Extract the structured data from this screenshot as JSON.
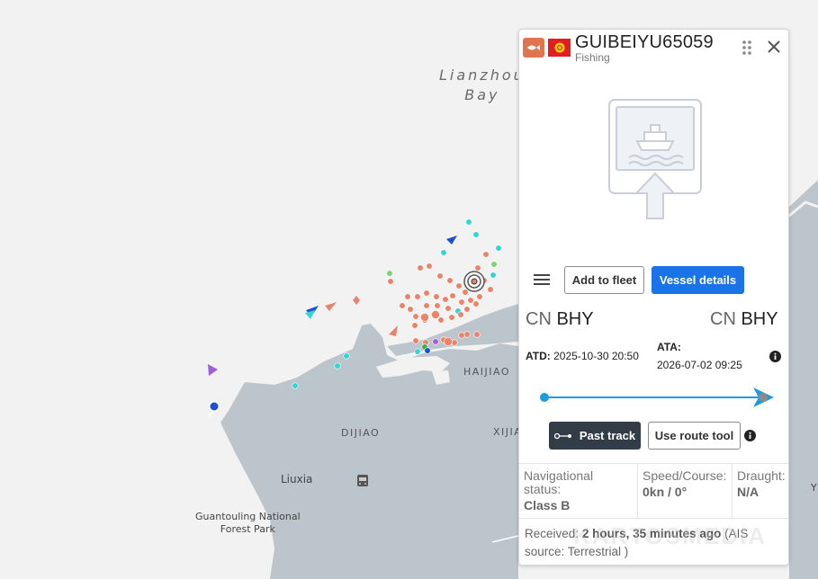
{
  "map": {
    "bay_label_line1": "Lianzhou",
    "bay_label_line2": "Bay",
    "places": {
      "haijiao": "HAIJIAO",
      "dijiao": "DIJIAO",
      "xijiao": "XIJIAO",
      "liuxia": "Liuxia",
      "park_line1": "Guantouling National",
      "park_line2": "Forest Park",
      "right_edge": "Y"
    },
    "colors": {
      "water": "#f2f2f2",
      "land": "#bcc4cc",
      "cargo_vessel": "#e8846a",
      "passenger_vessel": "#35d4d4",
      "pleasure_vessel": "#a15ce0",
      "tanker_vessel": "#1a4fd6"
    }
  },
  "panel": {
    "vessel_name": "GUIBEIYU65059",
    "vessel_type": "Fishing",
    "type_icon": "fishing-boat-icon",
    "flag_icon": "kyrgyzstan-flag-icon",
    "buttons": {
      "add_to_fleet": "Add to fleet",
      "vessel_details": "Vessel details",
      "past_track": "Past track",
      "use_route_tool": "Use route tool"
    },
    "departure": {
      "country": "CN",
      "port": "BHY"
    },
    "arrival": {
      "country": "CN",
      "port": "BHY"
    },
    "atd_label": "ATD:",
    "atd_value": "2025-10-30 20:50",
    "ata_label": "ATA:",
    "ata_value": "2026-07-02 09:25",
    "nav_status_label": "Navigational status:",
    "nav_status_value": "Class B",
    "speed_label": "Speed/Course:",
    "speed_value": "0kn / 0°",
    "draught_label": "Draught:",
    "draught_value": "N/A",
    "received_prefix": "Received:",
    "received_age": "2 hours, 35 minutes ago",
    "received_suffix": "(AIS source: Terrestrial )",
    "watermark": "KARTOSMEDIA",
    "colors": {
      "primary": "#1a73e8",
      "dark_button": "#333d47",
      "route_line": "#1b9be0",
      "badge": "#e0744f",
      "flag": "#e31b23"
    }
  }
}
